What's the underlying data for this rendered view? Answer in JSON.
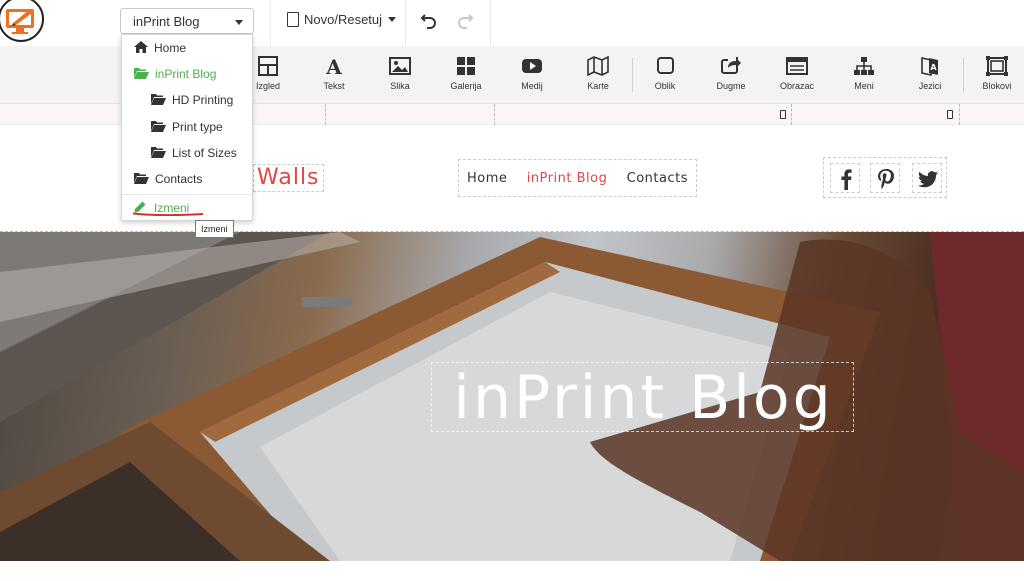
{
  "topbar": {
    "page_select": "inPrint Blog",
    "novo": "Novo/Resetuj"
  },
  "toolbar": {
    "items": [
      {
        "label": "Izgled",
        "icon": "layout-icon"
      },
      {
        "label": "Tekst",
        "icon": "text-icon"
      },
      {
        "label": "Slika",
        "icon": "image-icon"
      },
      {
        "label": "Galerija",
        "icon": "gallery-icon"
      },
      {
        "label": "Medij",
        "icon": "video-icon"
      },
      {
        "label": "Karte",
        "icon": "map-icon"
      },
      {
        "label": "Oblik",
        "icon": "shape-icon"
      },
      {
        "label": "Dugme",
        "icon": "button-share-icon"
      },
      {
        "label": "Obrazac",
        "icon": "form-icon"
      },
      {
        "label": "Meni",
        "icon": "sitemap-icon"
      },
      {
        "label": "Jezici",
        "icon": "language-icon"
      },
      {
        "label": "Blokovi",
        "icon": "blocks-icon"
      }
    ]
  },
  "dropdown": {
    "items": [
      {
        "label": "Home",
        "icon": "home-icon"
      },
      {
        "label": "inPrint Blog",
        "icon": "folder-open-icon"
      },
      {
        "label": "HD Printing",
        "icon": "folder-open-icon"
      },
      {
        "label": "Print type",
        "icon": "folder-open-icon"
      },
      {
        "label": "List of Sizes",
        "icon": "folder-open-icon"
      },
      {
        "label": "Contacts",
        "icon": "folder-open-icon"
      }
    ],
    "edit_label": "Izmeni",
    "tooltip": "Izmeni"
  },
  "site": {
    "brand_fragment": "Walls",
    "nav": [
      {
        "label": "Home",
        "active": false
      },
      {
        "label": "inPrint Blog",
        "active": true
      },
      {
        "label": "Contacts",
        "active": false
      }
    ],
    "social": [
      "facebook-icon",
      "pinterest-icon",
      "twitter-icon"
    ],
    "hero_title": "inPrint Blog"
  },
  "colors": {
    "accent_red": "#e04848",
    "active_green": "#4caf50",
    "logo_orange": "#f07020"
  }
}
